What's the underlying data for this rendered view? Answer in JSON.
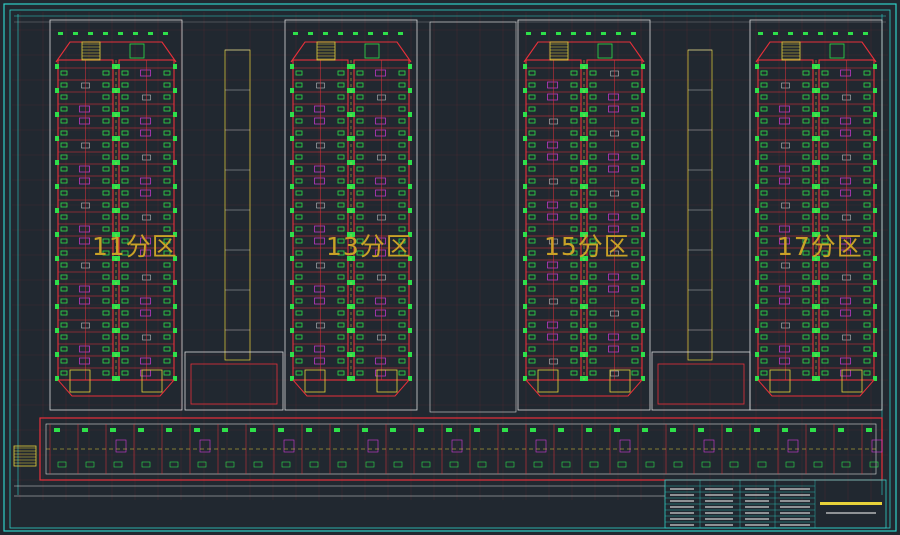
{
  "zones": [
    {
      "label": "11分区"
    },
    {
      "label": "13分区"
    },
    {
      "label": "15分区"
    },
    {
      "label": "17分区"
    }
  ],
  "colors": {
    "background": "#212830",
    "frame": "#2fd0c8",
    "wall": "#e8303a",
    "green": "#2ee04a",
    "yellow": "#e8d23a",
    "magenta": "#d13ad6",
    "white": "#d9d9d9",
    "label": "#c9a227"
  }
}
